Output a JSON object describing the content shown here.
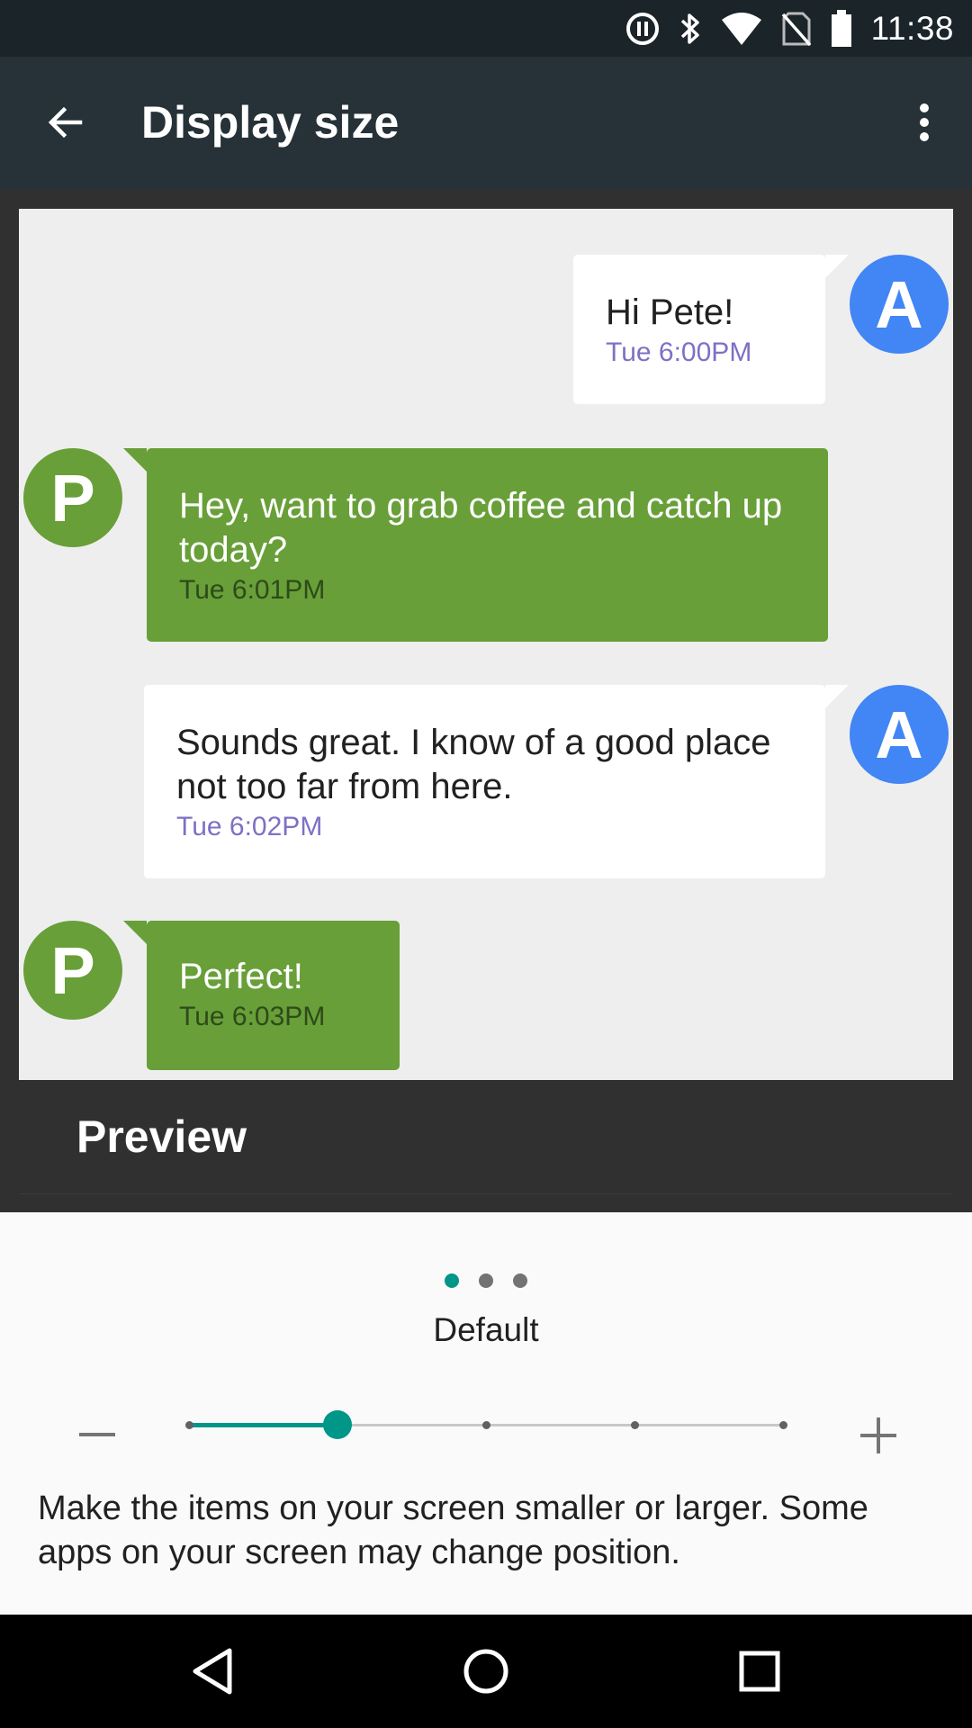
{
  "status_bar": {
    "time": "11:38",
    "icons": [
      "pause-circle-icon",
      "bluetooth-icon",
      "wifi-icon",
      "no-sim-icon",
      "battery-icon"
    ]
  },
  "app_bar": {
    "title": "Display size",
    "back_icon": "arrow-back-icon",
    "menu_icon": "more-vert-icon"
  },
  "preview": {
    "label": "Preview",
    "messages": [
      {
        "from": "A",
        "direction": "out",
        "text": "Hi Pete!",
        "time": "Tue 6:00PM"
      },
      {
        "from": "P",
        "direction": "in",
        "text": "Hey, want to grab coffee and catch up today?",
        "time": "Tue 6:01PM"
      },
      {
        "from": "A",
        "direction": "out",
        "text": "Sounds great. I know of a good place not too far from here.",
        "time": "Tue 6:02PM"
      },
      {
        "from": "P",
        "direction": "in",
        "text": "Perfect!",
        "time": "Tue 6:03PM"
      }
    ]
  },
  "size_control": {
    "page_count": 3,
    "active_page": 0,
    "current_label": "Default",
    "steps": 5,
    "selected_step": 1,
    "description": "Make the items on your screen smaller or larger. Some apps on your screen may change position."
  },
  "colors": {
    "accent": "#009688",
    "avatar_a": "#4285f4",
    "avatar_p": "#689f38",
    "app_bar": "#263238",
    "timestamp_out": "#7e70c4"
  },
  "nav_bar": {
    "icons": [
      "back-triangle-icon",
      "home-circle-icon",
      "recents-square-icon"
    ]
  }
}
